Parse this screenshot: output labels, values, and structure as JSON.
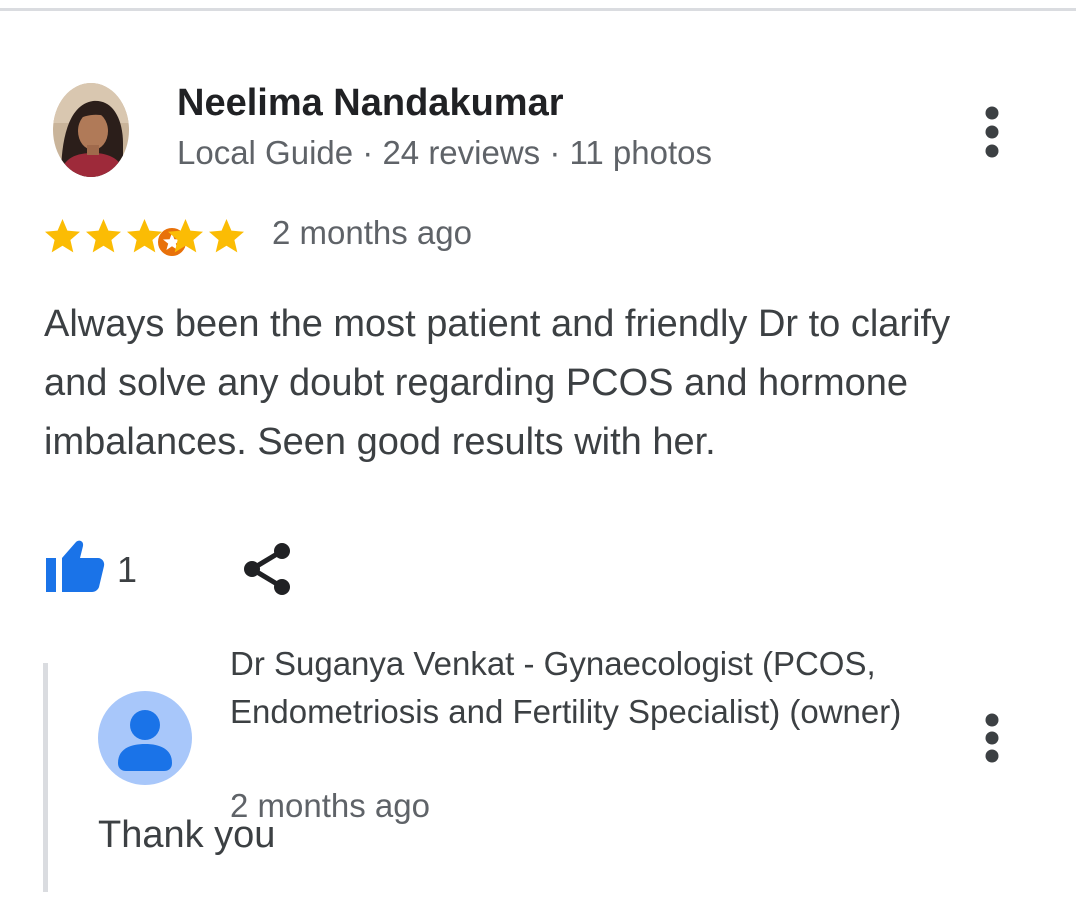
{
  "review": {
    "reviewer_name": "Neelima Nandakumar",
    "reviewer_meta": "Local Guide · 24 reviews · 11 photos",
    "rating": 5,
    "rating_max": 5,
    "date": "2 months ago",
    "text": "Always been the most patient and friendly Dr to clarify and solve any doubt regarding PCOS and hormone imbalances. Seen good results with her.",
    "like_count": "1"
  },
  "reply": {
    "owner_name": "Dr Suganya Venkat - Gynaecologist (PCOS, Endometriosis and Fertility Specialist) (owner)",
    "date": "2 months ago",
    "text": "Thank you"
  },
  "icons": {
    "reviewer_avatar": "reviewer-photo-avatar",
    "badge": "local-guide-star-badge",
    "star": "star-icon",
    "more": "more-vert-icon",
    "like": "thumbs-up-icon",
    "share": "share-icon",
    "owner_avatar": "person-avatar-icon"
  },
  "colors": {
    "star": "#fbbc04",
    "like": "#1a73e8",
    "badge": "#e8710a",
    "owner_avatar_bg": "#a8c7fa",
    "owner_avatar_fg": "#1a73e8",
    "text_primary": "#202124",
    "text_secondary": "#5f6368"
  }
}
